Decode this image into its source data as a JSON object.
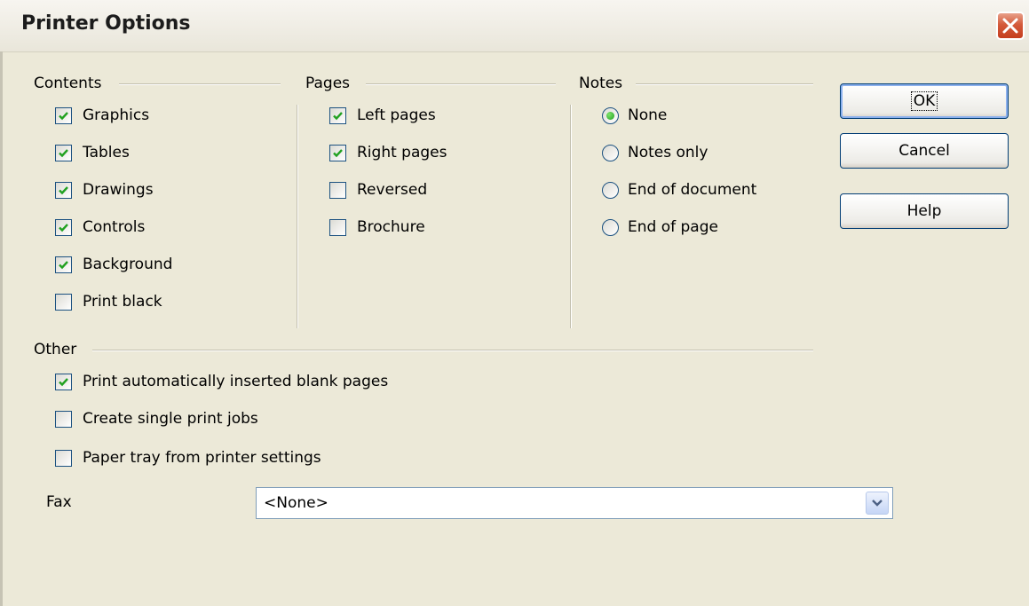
{
  "window": {
    "title": "Printer Options"
  },
  "groups": {
    "contents": {
      "label": "Contents",
      "items": [
        {
          "label": "Graphics",
          "checked": true
        },
        {
          "label": "Tables",
          "checked": true
        },
        {
          "label": "Drawings",
          "checked": true
        },
        {
          "label": "Controls",
          "checked": true
        },
        {
          "label": "Background",
          "checked": true
        },
        {
          "label": "Print black",
          "checked": false
        }
      ]
    },
    "pages": {
      "label": "Pages",
      "items": [
        {
          "label": "Left pages",
          "checked": true
        },
        {
          "label": "Right pages",
          "checked": true
        },
        {
          "label": "Reversed",
          "checked": false
        },
        {
          "label": "Brochure",
          "checked": false
        }
      ]
    },
    "notes": {
      "label": "Notes",
      "options": [
        {
          "label": "None",
          "selected": true
        },
        {
          "label": "Notes only",
          "selected": false
        },
        {
          "label": "End of document",
          "selected": false
        },
        {
          "label": "End of page",
          "selected": false
        }
      ]
    },
    "other": {
      "label": "Other",
      "items": [
        {
          "label": "Print automatically inserted blank pages",
          "checked": true
        },
        {
          "label": "Create single print jobs",
          "checked": false
        },
        {
          "label": "Paper tray from printer settings",
          "checked": false
        }
      ],
      "fax": {
        "label": "Fax",
        "value": "<None>"
      }
    }
  },
  "buttons": {
    "ok": "OK",
    "cancel": "Cancel",
    "help": "Help"
  },
  "colors": {
    "dialog_bg": "#ece9d8",
    "check_green": "#21a121",
    "close_red": "#d45a3a",
    "button_border": "#003c74"
  }
}
